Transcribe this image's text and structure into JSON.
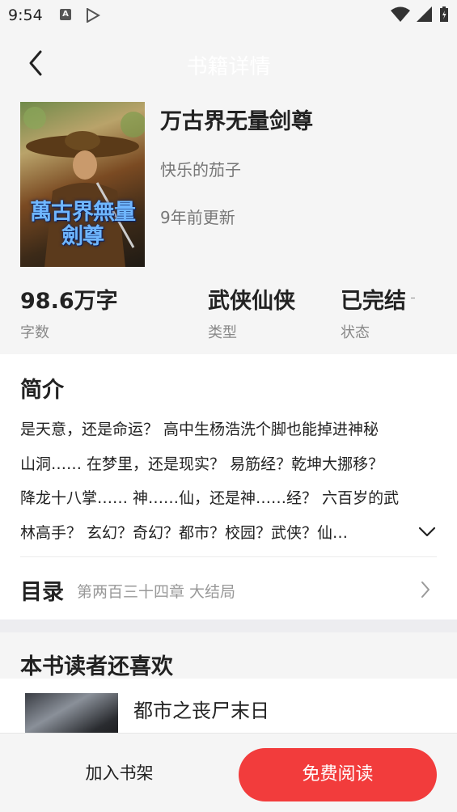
{
  "status_bar": {
    "time": "9:54",
    "icons": [
      "a-notification-icon",
      "play-store-icon",
      "wifi-icon",
      "signal-icon",
      "battery-icon"
    ]
  },
  "header": {
    "title": "书籍详情",
    "back_icon": "back-arrow-icon"
  },
  "book": {
    "cover_title": "萬古界無量劍尊",
    "title": "万古界无量剑尊",
    "author": "快乐的茄子",
    "updated": "9年前更新",
    "stats": [
      {
        "value": "98.6万字",
        "label": "字数"
      },
      {
        "value": "武侠仙侠",
        "label": "类型"
      },
      {
        "value": "已完结",
        "label": "状态"
      }
    ]
  },
  "intro": {
    "heading": "简介",
    "lines": [
      "是天意，还是命运？ 高中生杨浩洗个脚也能掉进神秘",
      "山洞…… 在梦里，还是现实？ 易筋经？乾坤大挪移？",
      "降龙十八掌…… 神……仙，还是神……经？ 六百岁的武",
      "林高手？ 玄幻？奇幻？都市？校园？武侠？仙…"
    ],
    "expand_icon": "chevron-down-icon"
  },
  "toc": {
    "label": "目录",
    "latest_chapter": "第两百三十四章 大结局",
    "arrow_icon": "chevron-right-icon"
  },
  "recommendations": {
    "heading": "本书读者还喜欢",
    "items": [
      {
        "title": "都市之丧尸末日"
      }
    ]
  },
  "actions": {
    "add_to_shelf": "加入书架",
    "read_free": "免费阅读"
  },
  "colors": {
    "accent": "#f23c3c",
    "background": "#f5f5f5",
    "card": "#ffffff"
  }
}
